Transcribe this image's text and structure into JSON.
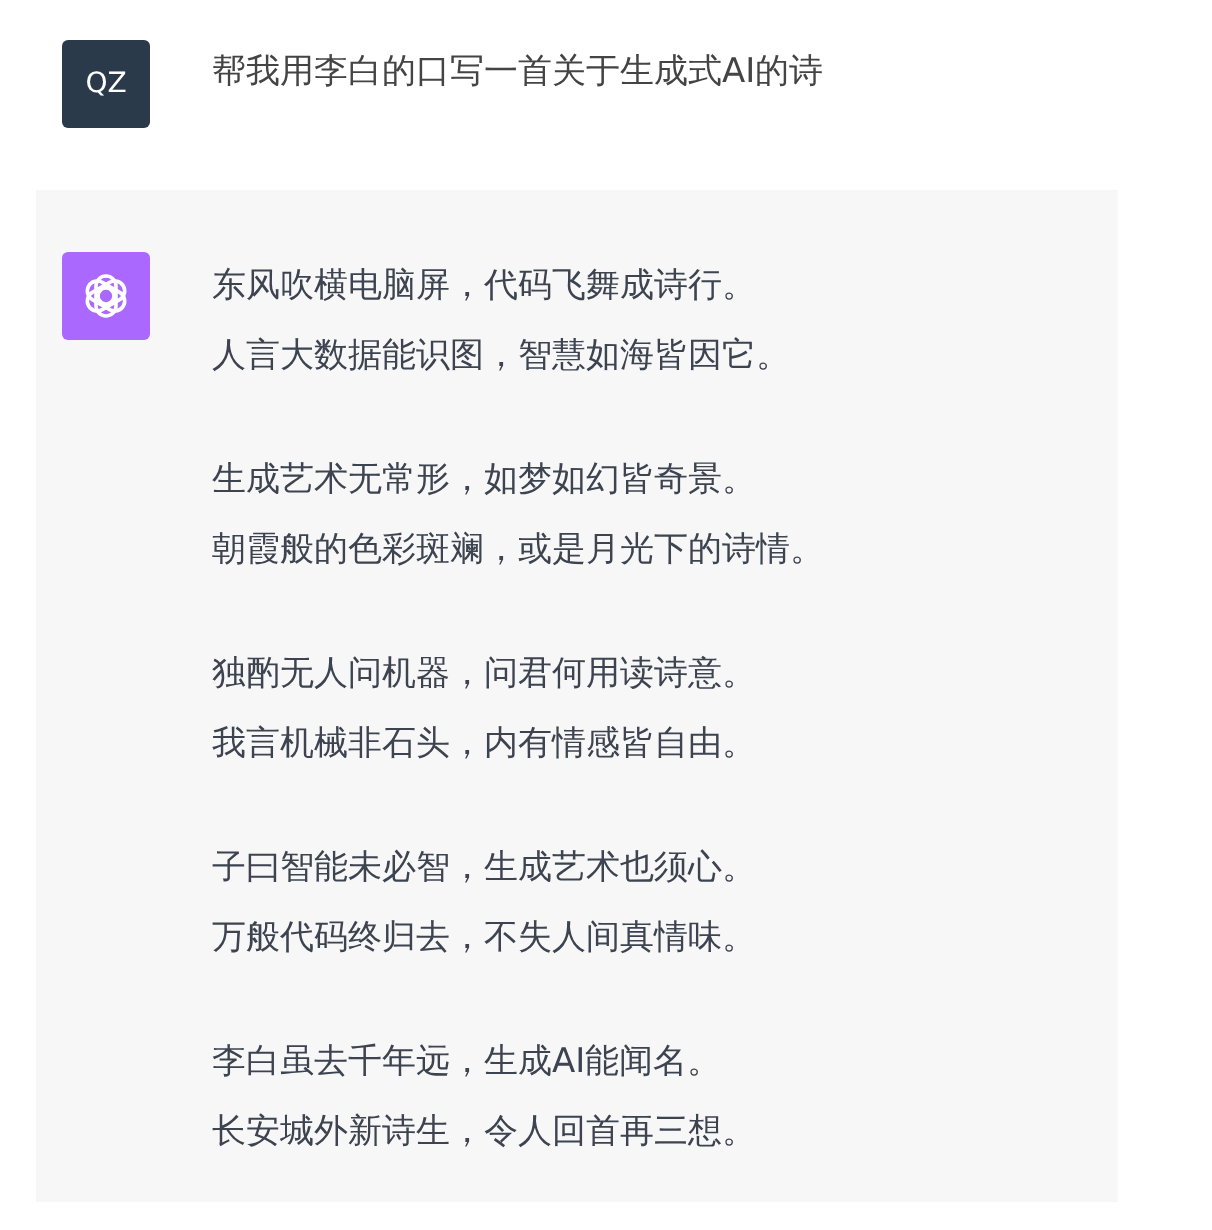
{
  "user_message": {
    "avatar": "QZ",
    "text": "帮我用李白的口写一首关于生成式AI的诗"
  },
  "assistant_message": {
    "stanzas": [
      [
        "东风吹横电脑屏，代码飞舞成诗行。",
        "人言大数据能识图，智慧如海皆因它。"
      ],
      [
        "生成艺术无常形，如梦如幻皆奇景。",
        "朝霞般的色彩斑斓，或是月光下的诗情。"
      ],
      [
        "独酌无人问机器，问君何用读诗意。",
        "我言机械非石头，内有情感皆自由。"
      ],
      [
        "子曰智能未必智，生成艺术也须心。",
        "万般代码终归去，不失人间真情味。"
      ],
      [
        "李白虽去千年远，生成AI能闻名。",
        "长安城外新诗生，令人回首再三想。"
      ]
    ]
  }
}
